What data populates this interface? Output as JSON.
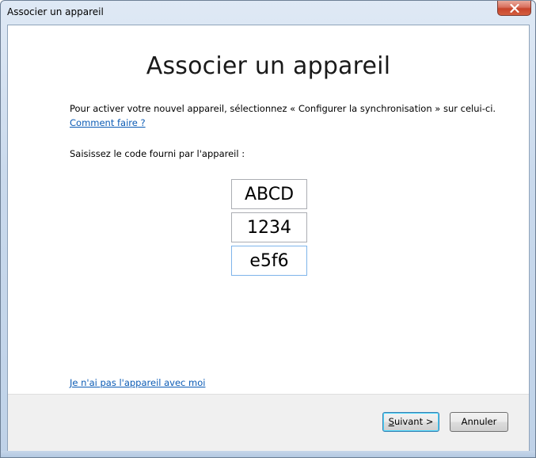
{
  "window": {
    "title": "Associer un appareil",
    "close_symbol": "×"
  },
  "main": {
    "heading": "Associer un appareil",
    "instruction": "Pour activer votre nouvel appareil, sélectionnez « Configurer la synchronisation » sur celui-ci.",
    "howto_link": "Comment faire ?",
    "code_prompt": "Saisissez le code fourni par l'appareil :",
    "codes": [
      "ABCD",
      "1234",
      "e5f6"
    ],
    "no_device_link": "Je n'ai pas l'appareil avec moi"
  },
  "footer": {
    "next_accel": "S",
    "next_rest": "uivant >",
    "cancel_label": "Annuler"
  },
  "colors": {
    "link": "#0b5bb5",
    "close_button": "#c7442b",
    "focus_border": "#7eb4ea"
  },
  "icons": {
    "close": "close-icon"
  }
}
